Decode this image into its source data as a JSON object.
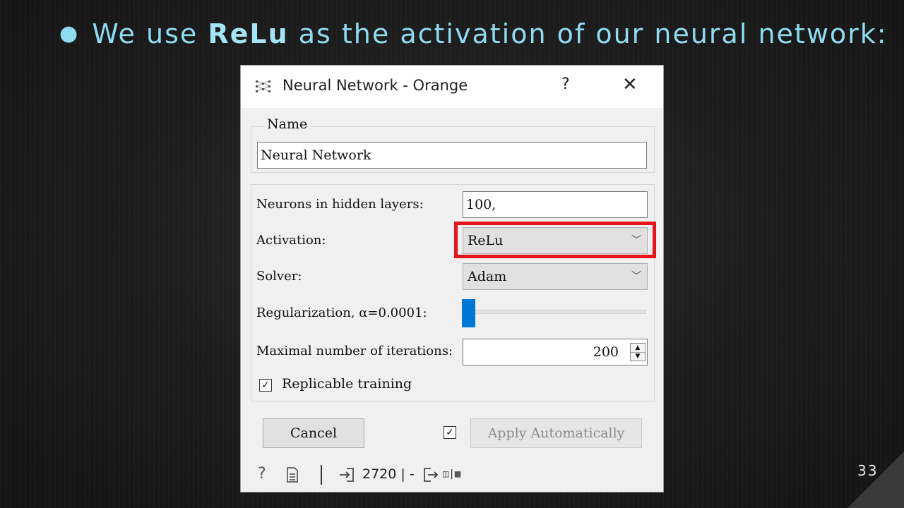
{
  "slide": {
    "title_prefix": "We use ",
    "title_bold": "ReLu",
    "title_suffix": " as the activation of our neural network:",
    "page_number": "33",
    "title_color": "#8fdcf2"
  },
  "window": {
    "title": "Neural Network - Orange",
    "help_label": "?",
    "close_label": "✕",
    "app_icon": "network-icon"
  },
  "name_group": {
    "label": "Name",
    "value": "Neural Network"
  },
  "params": {
    "neurons_label": "Neurons in hidden layers:",
    "neurons_value": "100,",
    "activation_label": "Activation:",
    "activation_value": "ReLu",
    "solver_label": "Solver:",
    "solver_value": "Adam",
    "regularization_label": "Regularization, α=0.0001:",
    "regularization_slider_level": 0.0,
    "max_iter_label": "Maximal number of iterations:",
    "max_iter_value": "200",
    "replicable_label": "Replicable training",
    "replicable_checked": true
  },
  "buttons": {
    "cancel_label": "Cancel",
    "apply_auto_checked": true,
    "apply_label": "Apply Automatically"
  },
  "status": {
    "input_text": "2720 | -",
    "output_text": "◫|▩"
  },
  "colors": {
    "highlight": "#e5151b",
    "slider_accent": "#0078d7"
  }
}
